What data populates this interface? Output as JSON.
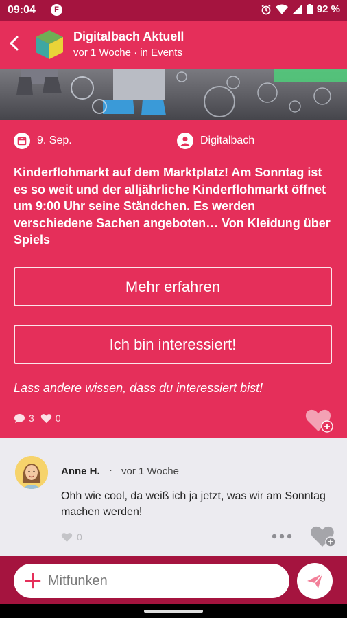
{
  "status_bar": {
    "time": "09:04",
    "battery": "92 %"
  },
  "header": {
    "title": "Digitalbach Aktuell",
    "subtitle": "vor 1 Woche · in Events"
  },
  "post": {
    "date": "9. Sep.",
    "author": "Digitalbach",
    "text": "Kinderflohmarkt auf dem Marktplatz! Am Sonntag ist es so weit und der alljährliche Kinderflohmarkt öffnet um 9:00 Uhr seine Ständchen. Es werden verschiedene Sachen angeboten… Von Kleidung über Spiels",
    "more_button": "Mehr erfahren",
    "interested_button": "Ich bin interessiert!",
    "hint": "Lass andere wissen, dass du interessiert bist!",
    "comment_count": "3",
    "like_count": "0"
  },
  "comment": {
    "author": "Anne H.",
    "separator": "·",
    "time": "vor 1 Woche",
    "text": "Ohh wie cool, da weiß ich ja jetzt, was wir am Sonntag machen werden!",
    "like_count": "0"
  },
  "composer": {
    "placeholder": "Mitfunken"
  },
  "colors": {
    "primary": "#e52f5a",
    "dark": "#a5143f",
    "background": "#ecebf0"
  },
  "icons": [
    "back-arrow-icon",
    "calendar-icon",
    "user-icon",
    "comment-icon",
    "heart-icon",
    "heart-plus-icon",
    "more-icon",
    "plus-icon",
    "send-icon"
  ]
}
